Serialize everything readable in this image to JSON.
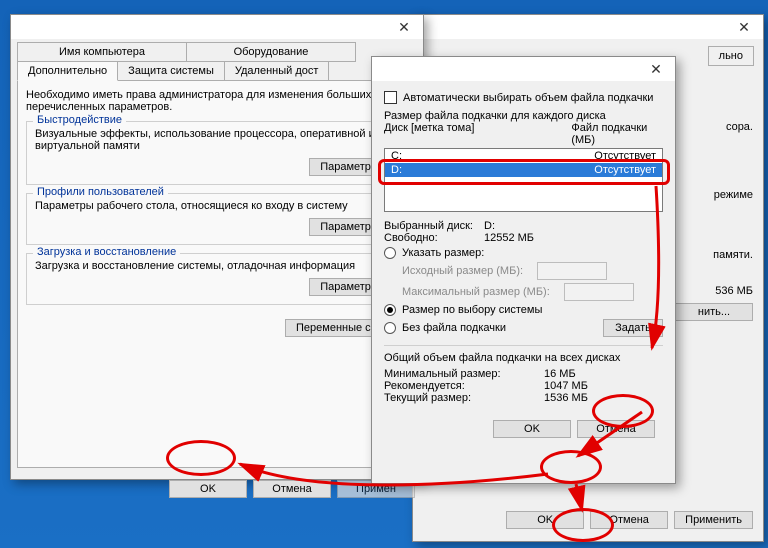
{
  "bg_dialog": {
    "tab_extra": "льно"
  },
  "sysprops": {
    "tabs_row1": [
      "Имя компьютера",
      "Оборудование"
    ],
    "tabs_row2": [
      "Дополнительно",
      "Защита системы",
      "Удаленный дост"
    ],
    "intro": "Необходимо иметь права администратора для изменения больших перечисленных параметров.",
    "perf": {
      "title": "Быстродействие",
      "desc": "Визуальные эффекты, использование процессора, оперативной и виртуальной памяти",
      "btn": "Параметры..."
    },
    "profiles": {
      "title": "Профили пользователей",
      "desc": "Параметры рабочего стола, относящиеся ко входу в систему",
      "btn": "Параметры..."
    },
    "startup": {
      "title": "Загрузка и восстановление",
      "desc": "Загрузка и восстановление системы, отладочная информация",
      "btn": "Параметры..."
    },
    "envvars_btn": "Переменные среды",
    "ok": "OK",
    "cancel": "Отмена",
    "apply": "Примен"
  },
  "perfopts": {
    "frag1": "сора.",
    "frag2": "режиме",
    "frag3": "памяти.",
    "size": "536 МБ",
    "change_btn": "нить...",
    "ok": "OK",
    "cancel": "Отмена",
    "apply": "Применить"
  },
  "vm": {
    "auto_chk": "Автоматически выбирать объем файла подкачки",
    "list_title": "Размер файла подкачки для каждого диска",
    "col_disk": "Диск [метка тома]",
    "col_pf": "Файл подкачки (МБ)",
    "rows": [
      {
        "drive": "C:",
        "value": "Отсутствует"
      },
      {
        "drive": "D:",
        "value": "Отсутствует"
      }
    ],
    "selected_label": "Выбранный диск:",
    "selected_val": "D:",
    "free_label": "Свободно:",
    "free_val": "12552 МБ",
    "r_custom": "Указать размер:",
    "r_custom_initial": "Исходный размер (МБ):",
    "r_custom_max": "Максимальный размер (МБ):",
    "r_system": "Размер по выбору системы",
    "r_none": "Без файла подкачки",
    "set_btn": "Задать",
    "total_title": "Общий объем файла подкачки на всех дисках",
    "min_l": "Минимальный размер:",
    "min_v": "16 МБ",
    "rec_l": "Рекомендуется:",
    "rec_v": "1047 МБ",
    "cur_l": "Текущий размер:",
    "cur_v": "1536 МБ",
    "ok": "OK",
    "cancel": "Отмена"
  }
}
